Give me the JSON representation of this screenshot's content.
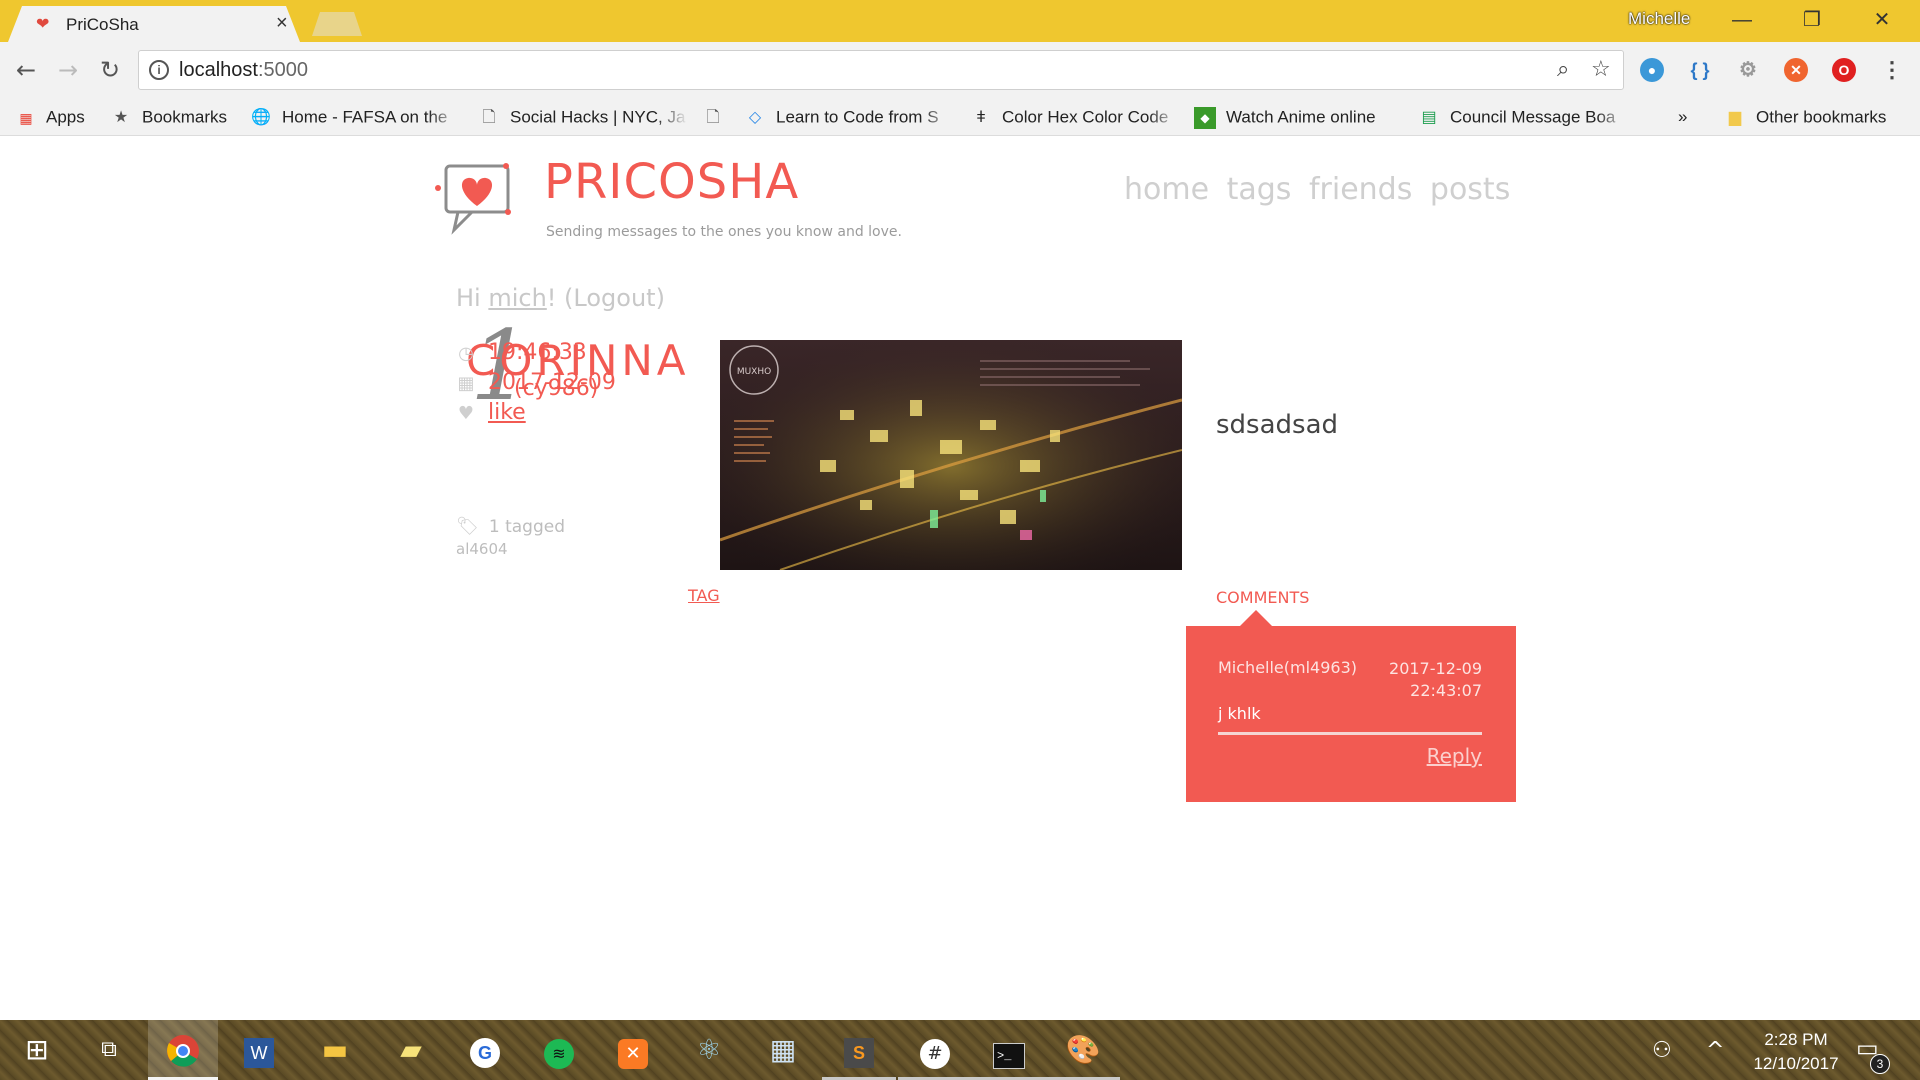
{
  "browser": {
    "tab_title": "PriCoSha",
    "tab_close": "×",
    "profile_name": "Michelle",
    "window_controls": {
      "minimize": "—",
      "restore": "❐",
      "close": "✕"
    },
    "url": "localhost",
    "url_port": ":5000",
    "nav": {
      "back": "←",
      "forward": "→",
      "reload": "↻"
    },
    "bookmarks": [
      {
        "label": "Apps",
        "icon": "apps-grid-icon"
      },
      {
        "label": "Bookmarks",
        "icon": "star-icon"
      },
      {
        "label": "Home - FAFSA on the",
        "icon": "globe-icon"
      },
      {
        "label": "Social Hacks | NYC, Ja",
        "icon": "page-icon"
      },
      {
        "label": "",
        "icon": "page-icon"
      },
      {
        "label": "Learn to Code from S",
        "icon": "code-icon"
      },
      {
        "label": "Color Hex Color Code",
        "icon": "dropper-icon"
      },
      {
        "label": "Watch Anime online",
        "icon": "anime-icon"
      },
      {
        "label": "Council Message Boa",
        "icon": "sheet-icon"
      }
    ],
    "bookmarks_overflow": "»",
    "other_bookmarks": "Other bookmarks"
  },
  "site": {
    "title": "PRICOSHA",
    "tagline": "Sending messages to the ones you know and love.",
    "nav": [
      "home",
      "tags",
      "friends",
      "posts"
    ],
    "greeting_prefix": "Hi ",
    "username": "mich",
    "greeting_suffix": "! ",
    "logout": "(Logout)"
  },
  "post": {
    "number": "1",
    "author_name": "CORINNA",
    "author_id": "(cy986)",
    "time": "19:46:33",
    "date": "2017-12-09",
    "like_label": "like",
    "tagged_count": "1 tagged",
    "tagged_user": "al4604",
    "body": "sdsadsad",
    "tag_label": "TAG",
    "comments_label": "COMMENTS",
    "image_badge": "MUXHO"
  },
  "comments": [
    {
      "author": "Michelle(ml4963)",
      "date": "2017-12-09",
      "time": "22:43:07",
      "text": "j khlk",
      "reply_label": "Reply"
    }
  ],
  "taskbar": {
    "clock_time": "2:28 PM",
    "clock_date": "12/10/2017",
    "notification_count": "3"
  },
  "colors": {
    "brand": "#f25a52",
    "titlebar": "#efc72f",
    "nav_text": "#cfcfcf"
  }
}
